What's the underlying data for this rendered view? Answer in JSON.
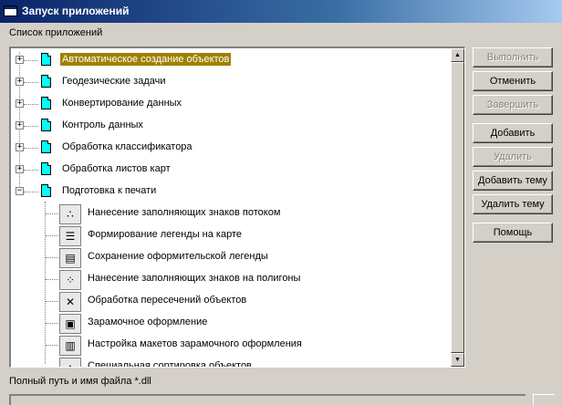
{
  "window": {
    "title": "Запуск приложений"
  },
  "list_label": "Список приложений",
  "tree": {
    "groups": [
      {
        "label": "Автоматическое создание объектов",
        "expander": "+",
        "selected": true
      },
      {
        "label": "Геодезические задачи",
        "expander": "+"
      },
      {
        "label": "Конвертирование данных",
        "expander": "+"
      },
      {
        "label": "Контроль данных",
        "expander": "+"
      },
      {
        "label": "Обработка классификатора",
        "expander": "+"
      },
      {
        "label": "Обработка листов карт",
        "expander": "+"
      },
      {
        "label": "Подготовка к печати",
        "expander": "−"
      }
    ],
    "children": [
      {
        "label": "Нанесение заполняющих знаков потоком",
        "icon": "fill-pattern-icon"
      },
      {
        "label": "Формирование легенды на карте",
        "icon": "legend-icon"
      },
      {
        "label": "Сохранение оформительской легенды",
        "icon": "legend-save-icon"
      },
      {
        "label": "Нанесение заполняющих знаков на полигоны",
        "icon": "polygon-fill-icon"
      },
      {
        "label": "Обработка пересечений объектов",
        "icon": "intersection-icon"
      },
      {
        "label": "Зарамочное оформление",
        "icon": "frame-icon"
      },
      {
        "label": "Настройка макетов зарамочного оформления",
        "icon": "frame-layout-icon"
      },
      {
        "label": "Специальная сортировка объектов",
        "icon": "sort-icon"
      }
    ]
  },
  "buttons": {
    "run": "Выполнить",
    "cancel": "Отменить",
    "finish": "Завершить",
    "add": "Добавить",
    "delete": "Удалить",
    "add_topic": "Добавить тему",
    "delete_topic": "Удалить тему",
    "help": "Помощь"
  },
  "path_label": "Полный путь и имя файла *.dll",
  "path_value": ""
}
